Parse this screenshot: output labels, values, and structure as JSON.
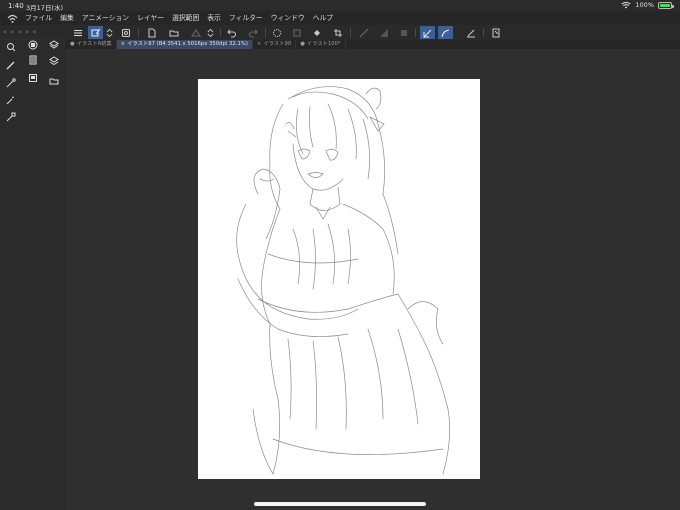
{
  "status_bar": {
    "time": "1:40",
    "date": "3月17日(水)",
    "battery_percent": "100%"
  },
  "menu": {
    "items": [
      "ファイル",
      "編集",
      "アニメーション",
      "レイヤー",
      "選択範囲",
      "表示",
      "フィルター",
      "ウィンドウ",
      "ヘルプ"
    ]
  },
  "tabs": [
    {
      "label": "イラスト6結集",
      "active": false
    },
    {
      "label": "イラスト87 (B4 3541 x 5016px 350dpi 32.1%)",
      "active": true
    },
    {
      "label": "イラスト98",
      "active": false
    },
    {
      "label": "イラスト100*",
      "active": false
    }
  ],
  "colors": {
    "accent": "#3b5f99",
    "panel": "#2b2b2b",
    "workspace": "#2f2f2f",
    "canvas": "#ffffff"
  },
  "icons": {
    "toolbar": [
      "menu-icon",
      "edit-canvas-icon",
      "stepper-icon",
      "paste-icon",
      "new-file-icon",
      "open-folder-icon",
      "warp-icon",
      "stepper-icon",
      "undo-icon",
      "redo-icon",
      "lasso-icon",
      "transform-icon",
      "fill-bucket-icon",
      "crop-icon",
      "ruler-icon",
      "gradient-icon",
      "shape-icon",
      "pen-stroke-icon",
      "pen-curve-icon",
      "line-icon",
      "memo-icon"
    ],
    "left_panel": [
      "zoom-icon",
      "pen-icon",
      "vector-pen-icon",
      "magic-pen-icon",
      "fill-pen-icon",
      "layers-icon",
      "stack-icon",
      "layer-property-icon",
      "navigator-icon",
      "material-icon",
      "folder-icon"
    ]
  }
}
